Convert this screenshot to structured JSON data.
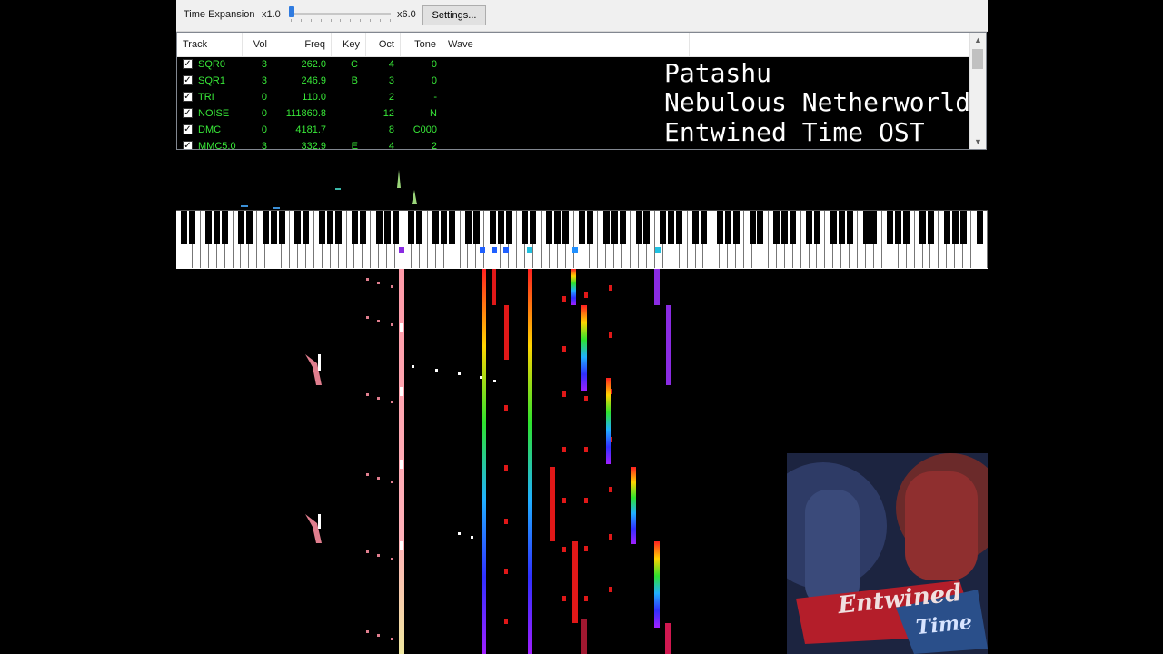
{
  "toolbar": {
    "time_expansion_label": "Time Expansion",
    "min_label": "x1.0",
    "max_label": "x6.0",
    "settings_label": "Settings..."
  },
  "track_table": {
    "headers": [
      "Track",
      "Vol",
      "Freq",
      "Key",
      "Oct",
      "Tone",
      "Wave"
    ],
    "rows": [
      {
        "name": "SQR0",
        "vol": "3",
        "freq": "262.0",
        "key": "C",
        "oct": "4",
        "tone": "0"
      },
      {
        "name": "SQR1",
        "vol": "3",
        "freq": "246.9",
        "key": "B",
        "oct": "3",
        "tone": "0"
      },
      {
        "name": "TRI",
        "vol": "0",
        "freq": "110.0",
        "key": "",
        "oct": "2",
        "tone": "-"
      },
      {
        "name": "NOISE",
        "vol": "0",
        "freq": "111860.8",
        "key": "",
        "oct": "12",
        "tone": "N"
      },
      {
        "name": "DMC",
        "vol": "0",
        "freq": "4181.7",
        "key": "",
        "oct": "8",
        "tone": "C000"
      },
      {
        "name": "MMC5:0",
        "vol": "3",
        "freq": "332.9",
        "key": "E",
        "oct": "4",
        "tone": "2"
      }
    ]
  },
  "song_info": {
    "artist": "Patashu",
    "song": "Nebulous Netherworld",
    "album": "Entwined Time OST"
  },
  "album_art": {
    "title": "Entwined",
    "subtitle": "Time"
  },
  "colors": {
    "track_text": "#38e838",
    "accent": "#2f7be0"
  }
}
